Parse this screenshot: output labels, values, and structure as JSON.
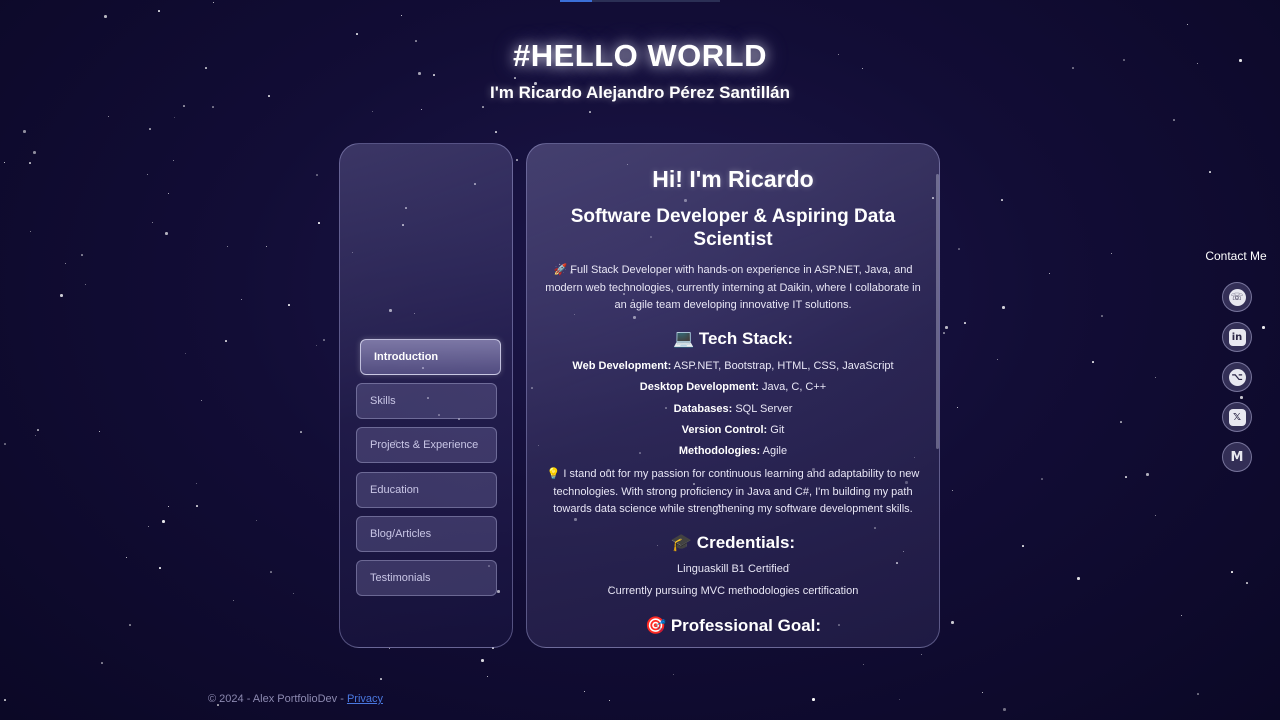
{
  "hero": {
    "title": "#HELLO WORLD",
    "subtitle": "I'm Ricardo Alejandro Pérez Santillán"
  },
  "nav": {
    "items": [
      {
        "label": "Introduction",
        "active": true
      },
      {
        "label": "Skills"
      },
      {
        "label": "Projects & Experience"
      },
      {
        "label": "Education"
      },
      {
        "label": "Blog/Articles"
      },
      {
        "label": "Testimonials"
      }
    ]
  },
  "content": {
    "greeting": "Hi! I'm Ricardo",
    "role": "Software Developer & Aspiring Data Scientist",
    "intro_icon": "rocket-icon",
    "intro": "🚀 Full Stack Developer with hands-on experience in ASP.NET, Java, and modern web technologies, currently interning at Daikin, where I collaborate in an agile team developing innovative IT solutions.",
    "tech_heading": "💻 Tech Stack:",
    "tech": [
      {
        "label": "Web Development:",
        "value": " ASP.NET, Bootstrap, HTML, CSS, JavaScript"
      },
      {
        "label": "Desktop Development:",
        "value": " Java, C, C++"
      },
      {
        "label": "Databases:",
        "value": " SQL Server"
      },
      {
        "label": "Version Control:",
        "value": " Git"
      },
      {
        "label": "Methodologies:",
        "value": " Agile"
      }
    ],
    "passion": "💡 I stand out for my passion for continuous learning and adaptability to new technologies. With strong proficiency in Java and C#, I'm building my path towards data science while strengthening my software development skills.",
    "credentials_heading": "🎓 Credentials:",
    "credentials": [
      "Linguaskill B1 Certified",
      "Currently pursuing MVC methodologies certification"
    ],
    "goal_heading": "🎯 Professional Goal:"
  },
  "footer": {
    "text": "© 2024 - Alex PortfolioDev - ",
    "link": "Privacy"
  },
  "contact": {
    "title": "Contact Me",
    "links": [
      {
        "name": "whatsapp-icon",
        "glyph": "☏"
      },
      {
        "name": "linkedin-icon",
        "glyph": "in"
      },
      {
        "name": "github-icon",
        "glyph": "⌥"
      },
      {
        "name": "x-icon",
        "glyph": "𝕏"
      },
      {
        "name": "gmail-icon",
        "glyph": "M"
      }
    ]
  },
  "colors": {
    "background": "#120d36",
    "link": "#4a78e0",
    "accent": "#3b6fd8"
  }
}
